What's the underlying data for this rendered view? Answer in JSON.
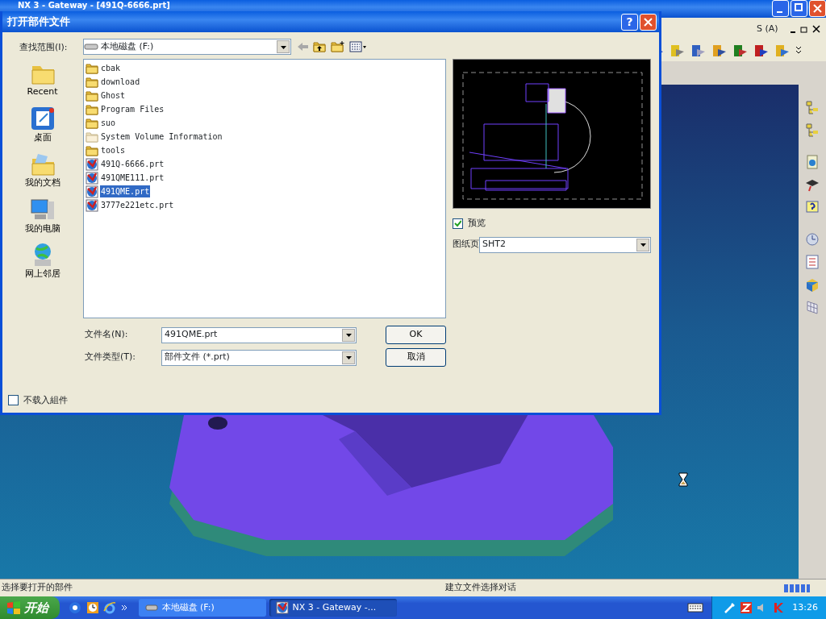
{
  "app": {
    "title": "NX 3 - Gateway - [491Q-6666.prt]",
    "menu": [
      "S (A)"
    ],
    "status_left": "选择要打开的部件",
    "status_right": "建立文件选择对话"
  },
  "dialog": {
    "title": "打开部件文件",
    "help_button": "?",
    "look_in_label": "查找范围(I):",
    "look_in": "本地磁盘 (F:)",
    "places": [
      {
        "label": "Recent",
        "kind": "recent"
      },
      {
        "label": "桌面",
        "kind": "desktop"
      },
      {
        "label": "我的文档",
        "kind": "documents"
      },
      {
        "label": "我的电脑",
        "kind": "computer"
      },
      {
        "label": "网上邻居",
        "kind": "network"
      }
    ],
    "files": [
      {
        "name": "cbak",
        "kind": "folder",
        "selected": false
      },
      {
        "name": "download",
        "kind": "folder",
        "selected": false
      },
      {
        "name": "Ghost",
        "kind": "folder",
        "selected": false
      },
      {
        "name": "Program Files",
        "kind": "folder",
        "selected": false
      },
      {
        "name": "suo",
        "kind": "folder",
        "selected": false
      },
      {
        "name": "System Volume Information",
        "kind": "hidden-folder",
        "selected": false
      },
      {
        "name": "tools",
        "kind": "folder",
        "selected": false
      },
      {
        "name": "491Q-6666.prt",
        "kind": "part",
        "selected": false
      },
      {
        "name": "491QME111.prt",
        "kind": "part",
        "selected": false
      },
      {
        "name": "491QME.prt",
        "kind": "part",
        "selected": true
      },
      {
        "name": "3777e221etc.prt",
        "kind": "part",
        "selected": false
      }
    ],
    "file_name_label": "文件名(N):",
    "file_name": "491QME.prt",
    "file_type_label": "文件类型(T):",
    "file_type": "部件文件 (*.prt)",
    "ok": "OK",
    "cancel": "取消",
    "preview": {
      "label": "预览",
      "checked": true
    },
    "sheet_label": "图纸页",
    "sheet": "SHT2",
    "no_load": {
      "label": "不载入組件",
      "checked": false
    }
  },
  "taskbar": {
    "start": "开始",
    "tasks": [
      {
        "label": "本地磁盘 (F:)",
        "kind": "drive",
        "selected": false
      },
      {
        "label": "NX 3 - Gateway -...",
        "kind": "nx",
        "selected": true
      }
    ],
    "clock": "13:26"
  }
}
